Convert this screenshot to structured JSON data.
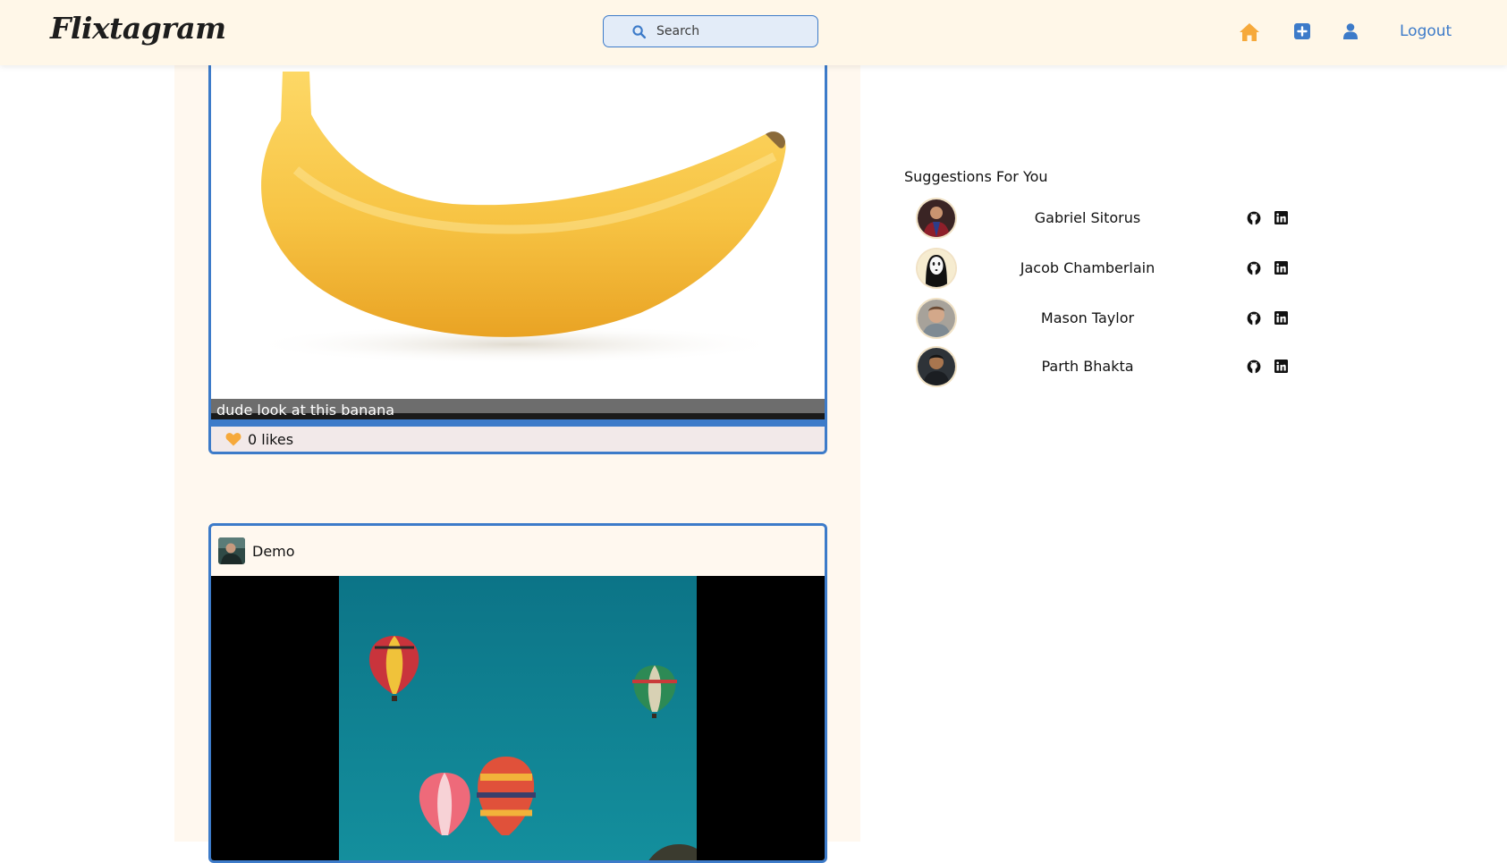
{
  "nav": {
    "brand": "Flixtagram",
    "search_placeholder": "Search",
    "logout_label": "Logout",
    "icons": [
      "home-icon",
      "add-post-icon",
      "profile-icon"
    ],
    "colors": {
      "accent": "#3d7bc9",
      "home": "#f6a93b",
      "bar_bg": "#fff7e8"
    }
  },
  "feed": {
    "posts": [
      {
        "caption": "dude look at this banana",
        "likes_label": "0 likes"
      },
      {
        "username": "Demo"
      }
    ]
  },
  "suggestions": {
    "title": "Suggestions For You",
    "users": [
      {
        "name": "Gabriel Sitorus"
      },
      {
        "name": "Jacob Chamberlain"
      },
      {
        "name": "Mason Taylor"
      },
      {
        "name": "Parth Bhakta"
      }
    ]
  }
}
